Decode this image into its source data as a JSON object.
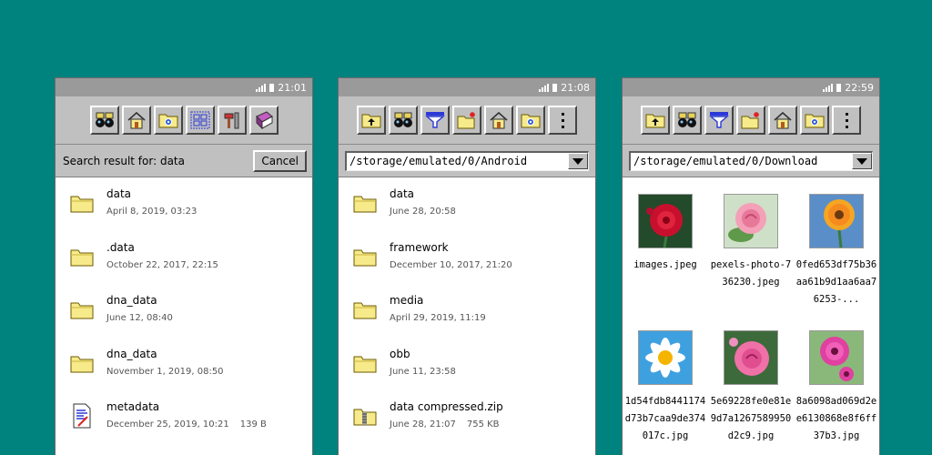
{
  "colors": {
    "background": "#00827f",
    "toolbar": "#c0c0c0",
    "statusbar": "#9a9a9a",
    "content": "#ffffff"
  },
  "screens": [
    {
      "status": {
        "time": "21:01"
      },
      "toolbar": [
        "binoculars-icon",
        "home-icon",
        "folder-settings-icon",
        "grid-view-icon",
        "tools-icon",
        "book-icon"
      ],
      "search": {
        "label": "Search result for: data",
        "cancel": "Cancel"
      },
      "items": [
        {
          "name": "data",
          "date": "April 8, 2019, 03:23",
          "size": "",
          "icon": "folder-icon"
        },
        {
          "name": ".data",
          "date": "October 22, 2017, 22:15",
          "size": "",
          "icon": "folder-icon"
        },
        {
          "name": "dna_data",
          "date": "June 12, 08:40",
          "size": "",
          "icon": "folder-icon"
        },
        {
          "name": "dna_data",
          "date": "November 1, 2019, 08:50",
          "size": "",
          "icon": "folder-icon"
        },
        {
          "name": "metadata",
          "date": "December 25, 2019, 10:21",
          "size": "139 B",
          "icon": "document-icon"
        }
      ]
    },
    {
      "status": {
        "time": "21:08"
      },
      "toolbar": [
        "folder-up-icon",
        "binoculars-icon",
        "filter-icon",
        "new-folder-icon",
        "home-icon",
        "folder-settings-icon",
        "more-icon"
      ],
      "path": "/storage/emulated/0/Android",
      "items": [
        {
          "name": "data",
          "date": "June 28, 20:58",
          "size": "",
          "icon": "folder-icon"
        },
        {
          "name": "framework",
          "date": "December 10, 2017, 21:20",
          "size": "",
          "icon": "folder-icon"
        },
        {
          "name": "media",
          "date": "April 29, 2019, 11:19",
          "size": "",
          "icon": "folder-icon"
        },
        {
          "name": "obb",
          "date": "June 11, 23:58",
          "size": "",
          "icon": "folder-icon"
        },
        {
          "name": "data compressed.zip",
          "date": "June 28, 21:07",
          "size": "755 KB",
          "icon": "zip-folder-icon"
        }
      ]
    },
    {
      "status": {
        "time": "22:59"
      },
      "toolbar": [
        "folder-up-icon",
        "binoculars-icon",
        "filter-icon",
        "new-folder-icon",
        "home-icon",
        "folder-settings-icon",
        "more-icon"
      ],
      "path": "/storage/emulated/0/Download",
      "images": [
        {
          "name": "images.jpeg",
          "thumb": "red-dahlia"
        },
        {
          "name": "pexels-photo-736230.jpeg",
          "thumb": "pink-rose"
        },
        {
          "name": "0fed653df75b36aa61b9d1aa6aa76253-...",
          "thumb": "orange-gerbera"
        },
        {
          "name": "1d54fdb8441174d73b7caa9de374017c.jpg",
          "thumb": "white-daisy"
        },
        {
          "name": "5e69228fe0e81e9d7a1267589950d2c9.jpg",
          "thumb": "pink-rose-2"
        },
        {
          "name": "8a6098ad069d2ee6130868e8f6ff37b3.jpg",
          "thumb": "pink-gerbera"
        }
      ]
    }
  ]
}
